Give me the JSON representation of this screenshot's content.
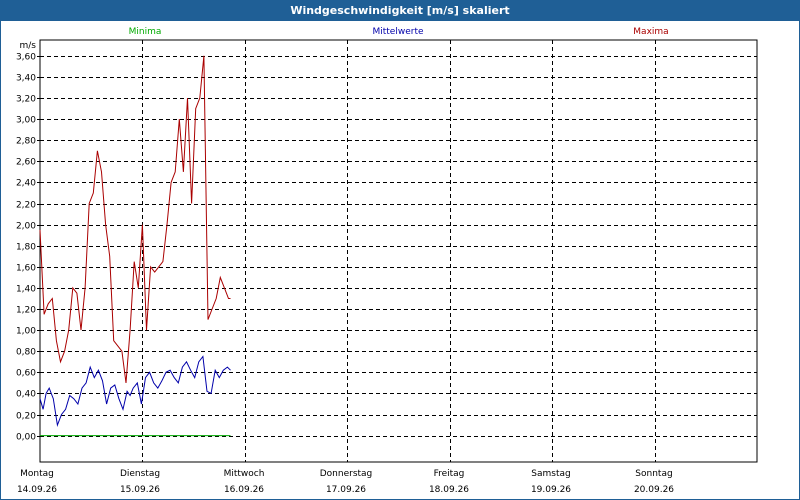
{
  "window": {
    "title": "Windgeschwindigkeit [m/s] skaliert"
  },
  "colors": {
    "titlebar": "#1f5f96",
    "minima": "#00aa00",
    "mittelwerte": "#0000aa",
    "maxima": "#aa0000"
  },
  "chart_data": {
    "type": "line",
    "title": "Windgeschwindigkeit [m/s] skaliert",
    "ylabel": "m/s",
    "ylim": [
      -0.25,
      3.75
    ],
    "yticks": [
      "0,00",
      "0,20",
      "0,40",
      "0,60",
      "0,80",
      "1,00",
      "1,20",
      "1,40",
      "1,60",
      "1,80",
      "2,00",
      "2,20",
      "2,40",
      "2,60",
      "2,80",
      "3,00",
      "3,20",
      "3,40",
      "3,60"
    ],
    "ytick_values": [
      0,
      0.2,
      0.4,
      0.6,
      0.8,
      1.0,
      1.2,
      1.4,
      1.6,
      1.8,
      2.0,
      2.2,
      2.4,
      2.6,
      2.8,
      3.0,
      3.2,
      3.4,
      3.6
    ],
    "xlim": [
      0,
      7
    ],
    "grid": true,
    "days": [
      {
        "name": "Montag",
        "date": "14.09.26"
      },
      {
        "name": "Dienstag",
        "date": "15.09.26"
      },
      {
        "name": "Mittwoch",
        "date": "16.09.26"
      },
      {
        "name": "Donnerstag",
        "date": "17.09.26"
      },
      {
        "name": "Freitag",
        "date": "18.09.26"
      },
      {
        "name": "Samstag",
        "date": "19.09.26"
      },
      {
        "name": "Sonntag",
        "date": "20.09.26"
      }
    ],
    "legend": [
      "Minima",
      "Mittelwerte",
      "Maxima"
    ],
    "series": [
      {
        "name": "Minima",
        "color": "#00aa00",
        "x": [
          0,
          1.86
        ],
        "y": [
          0,
          0
        ]
      },
      {
        "name": "Mittelwerte",
        "color": "#0000aa",
        "x": [
          0,
          0.03,
          0.06,
          0.09,
          0.13,
          0.17,
          0.21,
          0.25,
          0.29,
          0.33,
          0.37,
          0.41,
          0.45,
          0.49,
          0.53,
          0.57,
          0.61,
          0.65,
          0.69,
          0.73,
          0.77,
          0.81,
          0.85,
          0.88,
          0.91,
          0.95,
          0.99,
          1.03,
          1.07,
          1.11,
          1.15,
          1.19,
          1.23,
          1.27,
          1.31,
          1.35,
          1.39,
          1.43,
          1.47,
          1.51,
          1.55,
          1.59,
          1.63,
          1.67,
          1.71,
          1.75,
          1.79,
          1.83,
          1.86
        ],
        "y": [
          0.35,
          0.25,
          0.4,
          0.45,
          0.35,
          0.1,
          0.2,
          0.25,
          0.38,
          0.35,
          0.3,
          0.45,
          0.5,
          0.65,
          0.55,
          0.62,
          0.52,
          0.3,
          0.45,
          0.48,
          0.35,
          0.25,
          0.42,
          0.38,
          0.45,
          0.5,
          0.3,
          0.55,
          0.6,
          0.5,
          0.45,
          0.52,
          0.6,
          0.62,
          0.55,
          0.5,
          0.65,
          0.7,
          0.62,
          0.55,
          0.7,
          0.75,
          0.42,
          0.4,
          0.62,
          0.55,
          0.62,
          0.65,
          0.62
        ]
      },
      {
        "name": "Maxima",
        "color": "#aa0000",
        "x": [
          0,
          0.04,
          0.08,
          0.12,
          0.16,
          0.2,
          0.24,
          0.28,
          0.32,
          0.36,
          0.4,
          0.44,
          0.48,
          0.52,
          0.56,
          0.6,
          0.64,
          0.68,
          0.72,
          0.76,
          0.8,
          0.84,
          0.88,
          0.92,
          0.96,
          1.0,
          1.04,
          1.08,
          1.12,
          1.16,
          1.2,
          1.24,
          1.28,
          1.32,
          1.36,
          1.4,
          1.44,
          1.48,
          1.52,
          1.56,
          1.6,
          1.64,
          1.68,
          1.72,
          1.76,
          1.8,
          1.84,
          1.86
        ],
        "y": [
          1.95,
          1.15,
          1.25,
          1.3,
          0.9,
          0.7,
          0.8,
          1.0,
          1.4,
          1.35,
          1.0,
          1.4,
          2.2,
          2.3,
          2.7,
          2.5,
          2.0,
          1.7,
          0.9,
          0.85,
          0.8,
          0.5,
          1.0,
          1.65,
          1.4,
          2.0,
          1.0,
          1.6,
          1.55,
          1.6,
          1.65,
          2.0,
          2.4,
          2.5,
          3.0,
          2.5,
          3.2,
          2.2,
          3.1,
          3.2,
          3.6,
          1.1,
          1.2,
          1.3,
          1.5,
          1.4,
          1.3,
          1.3
        ]
      }
    ]
  }
}
